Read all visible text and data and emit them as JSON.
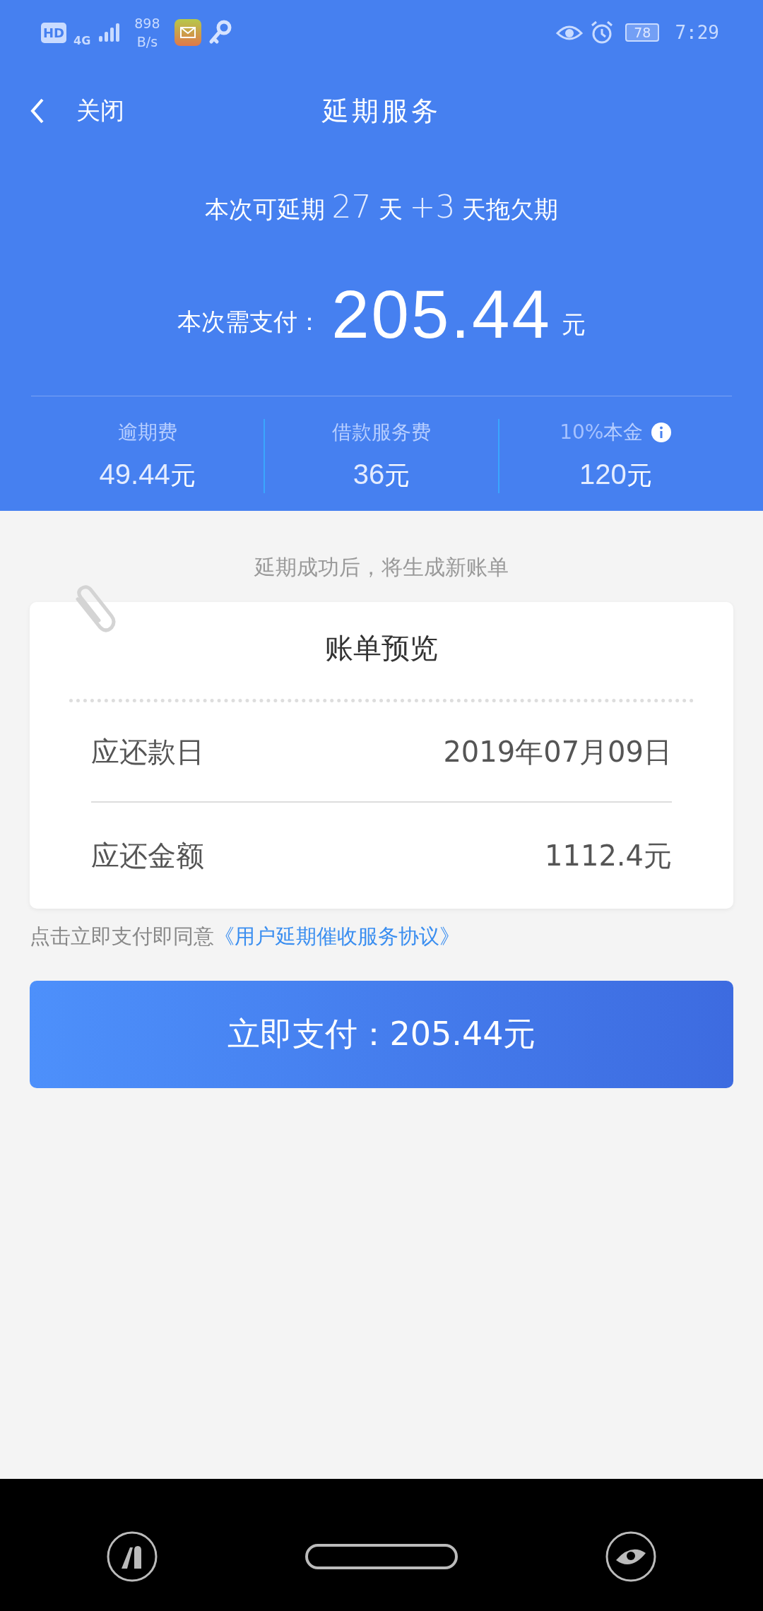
{
  "status_bar": {
    "hd": "HD",
    "network": "4G",
    "speed": "898",
    "speed_unit": "B/s",
    "battery": "78",
    "time": "7:29"
  },
  "header": {
    "back_label": "关闭",
    "title": "延期服务"
  },
  "extension": [
    {
      "kind": "text",
      "text": "本次可延期"
    },
    {
      "kind": "number",
      "text": "27"
    },
    {
      "kind": "text",
      "text": "天"
    },
    {
      "kind": "number",
      "text": "+3"
    },
    {
      "kind": "text",
      "text": "天拖欠期"
    }
  ],
  "payment": {
    "label": "本次需支付：",
    "amount": "205.44",
    "unit": "元"
  },
  "fees": [
    {
      "label": "逾期费",
      "value": "49.44",
      "unit": "元",
      "info": false
    },
    {
      "label": "借款服务费",
      "value": "36",
      "unit": "元",
      "info": false
    },
    {
      "prefix": "10%",
      "label": "本金",
      "value": "120",
      "unit": "元",
      "info": true
    }
  ],
  "note": "延期成功后，将生成新账单",
  "bill_preview": {
    "title": "账单预览",
    "rows": [
      {
        "label": "应还款日",
        "value": "2019年07月09日"
      },
      {
        "label": "应还金额",
        "value": "1112.4元"
      }
    ]
  },
  "agreement": {
    "text": "点击立即支付即同意",
    "link": "《用户延期催收服务协议》"
  },
  "pay_button": "立即支付：205.44元"
}
